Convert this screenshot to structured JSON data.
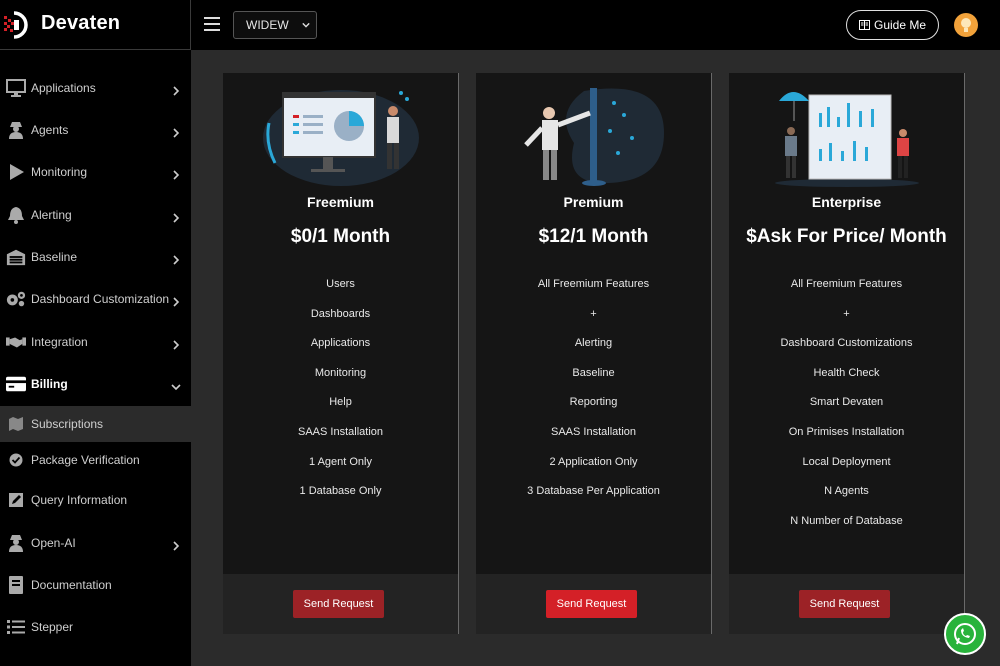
{
  "brand": {
    "name": "Devaten"
  },
  "sidebar": {
    "items": [
      {
        "label": "Applications",
        "icon": "monitor-icon",
        "has_children": true
      },
      {
        "label": "Agents",
        "icon": "agent-icon",
        "has_children": true
      },
      {
        "label": "Monitoring",
        "icon": "play-icon",
        "has_children": true
      },
      {
        "label": "Alerting",
        "icon": "bell-icon",
        "has_children": true
      },
      {
        "label": "Baseline",
        "icon": "garage-icon",
        "has_children": true
      },
      {
        "label": "Dashboard Customization",
        "icon": "gears-icon",
        "has_children": true
      },
      {
        "label": "Integration",
        "icon": "handshake-icon",
        "has_children": true
      },
      {
        "label": "Billing",
        "icon": "credit-card-icon",
        "has_children": true,
        "expanded": true
      },
      {
        "label": "Subscriptions",
        "icon": "map-icon",
        "sub": true,
        "selected": true
      },
      {
        "label": "Package Verification",
        "icon": "check-circle-icon",
        "sub": true
      },
      {
        "label": "Query Information",
        "icon": "edit-icon",
        "sub": true
      },
      {
        "label": "Open-AI",
        "icon": "agent-icon",
        "has_children": true
      },
      {
        "label": "Documentation",
        "icon": "book-icon"
      },
      {
        "label": "Stepper",
        "icon": "list-icon"
      }
    ]
  },
  "topbar": {
    "select_value": "WIDEW",
    "guide_label": "Guide Me"
  },
  "plans": [
    {
      "name": "Freemium",
      "price": "$0/1 Month",
      "features": [
        "Users",
        "Dashboards",
        "Applications",
        "Monitoring",
        "Help",
        "SAAS Installation",
        "1 Agent Only",
        "1 Database Only"
      ],
      "button": "Send Request",
      "button_color": "#9c2226"
    },
    {
      "name": "Premium",
      "price": "$12/1 Month",
      "features": [
        "All Freemium Features",
        "+",
        "Alerting",
        "Baseline",
        "Reporting",
        "SAAS Installation",
        "2 Application Only",
        "3 Database Per Application"
      ],
      "button": "Send Request",
      "button_color": "#d42027"
    },
    {
      "name": "Enterprise",
      "price": "$Ask For Price/ Month",
      "features": [
        "All Freemium Features",
        "+",
        "Dashboard Customizations",
        "Health Check",
        "Smart Devaten",
        "On Primises Installation",
        "Local Deployment",
        "N Agents",
        "N Number of Database"
      ],
      "button": "Send Request",
      "button_color": "#9c2226"
    }
  ],
  "colors": {
    "accent_red": "#d42027",
    "muted_red": "#9c2226",
    "illustration_blue": "#2aa8d8",
    "whatsapp_green": "#28b33b"
  }
}
